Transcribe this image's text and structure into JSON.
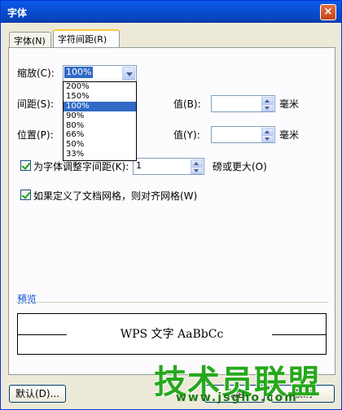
{
  "window": {
    "title": "字体",
    "close_glyph": "×"
  },
  "tabs": [
    {
      "label": "字体(N)"
    },
    {
      "label": "字符间距(R)"
    }
  ],
  "scale": {
    "label": "缩放(C):",
    "value": "100%",
    "options": [
      "200%",
      "150%",
      "100%",
      "90%",
      "80%",
      "66%",
      "50%",
      "33%"
    ],
    "selected_index": 2
  },
  "spacing": {
    "label": "间距(S):",
    "value_label": "值(B):",
    "value": "",
    "unit": "毫米"
  },
  "position": {
    "label": "位置(P):",
    "value_label": "值(Y):",
    "value": "",
    "unit": "毫米"
  },
  "kerning": {
    "checked": true,
    "label": "为字体调整字间距(K):",
    "value": "1",
    "suffix": "磅或更大(O)"
  },
  "grid": {
    "checked": true,
    "label": "如果定义了文档网格，则对齐网格(W)"
  },
  "preview": {
    "group_label": "预览",
    "sample_text": "WPS 文字 AaBbCc"
  },
  "buttons": {
    "default_label": "默认(D)...",
    "ok_label": "确定",
    "cancel_label": "取消"
  },
  "watermark": {
    "text": "技术员联盟",
    "url": "www.jsgho.com"
  }
}
